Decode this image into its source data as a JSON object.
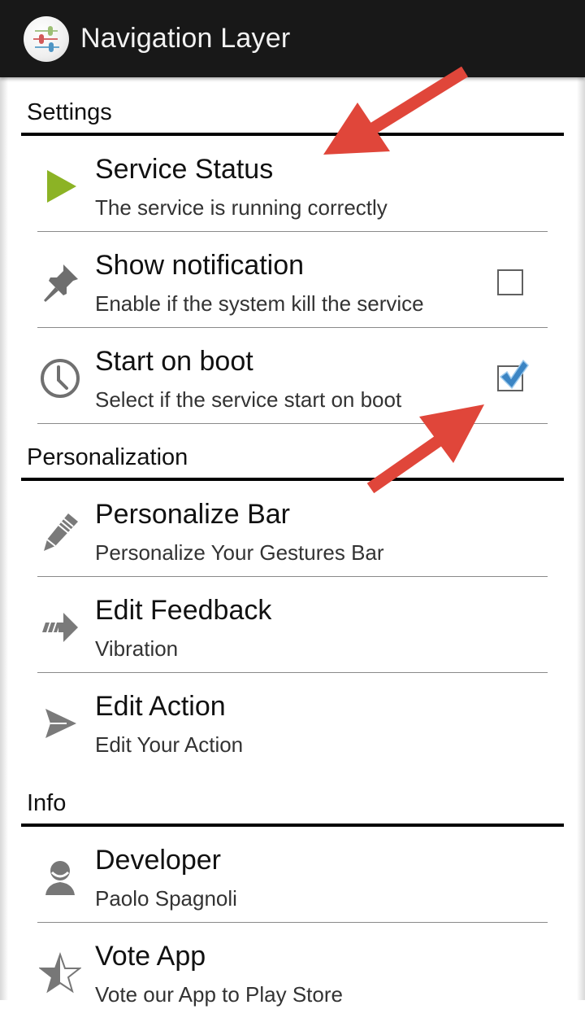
{
  "actionbar": {
    "title": "Navigation Layer",
    "icon": "sliders-app-icon"
  },
  "sections": [
    {
      "header": "Settings",
      "items": [
        {
          "title": "Service Status",
          "summary": "The service is running correctly",
          "icon": "play-icon",
          "icon_color": "#8cb325"
        },
        {
          "title": "Show notification",
          "summary": "Enable if the system kill the service",
          "icon": "pin-icon",
          "checkbox": true,
          "checked": false
        },
        {
          "title": "Start on boot",
          "summary": "Select if the service start on boot",
          "icon": "clock-icon",
          "checkbox": true,
          "checked": true
        }
      ]
    },
    {
      "header": "Personalization",
      "items": [
        {
          "title": "Personalize Bar",
          "summary": "Personalize Your Gestures Bar",
          "icon": "pencil-icon"
        },
        {
          "title": "Edit Feedback",
          "summary": "Vibration",
          "icon": "fast-forward-arrow-icon"
        },
        {
          "title": "Edit Action",
          "summary": "Edit Your Action",
          "icon": "send-icon"
        }
      ]
    },
    {
      "header": "Info",
      "items": [
        {
          "title": "Developer",
          "summary": "Paolo Spagnoli",
          "icon": "person-icon"
        },
        {
          "title": "Vote App",
          "summary": "Vote our App to Play Store",
          "icon": "half-star-icon"
        }
      ]
    }
  ],
  "colors": {
    "actionbar_bg": "#181818",
    "annotation_arrow": "#e0463a",
    "checkbox_check": "#3b85c4",
    "icon_gray": "#7a7a7a"
  }
}
